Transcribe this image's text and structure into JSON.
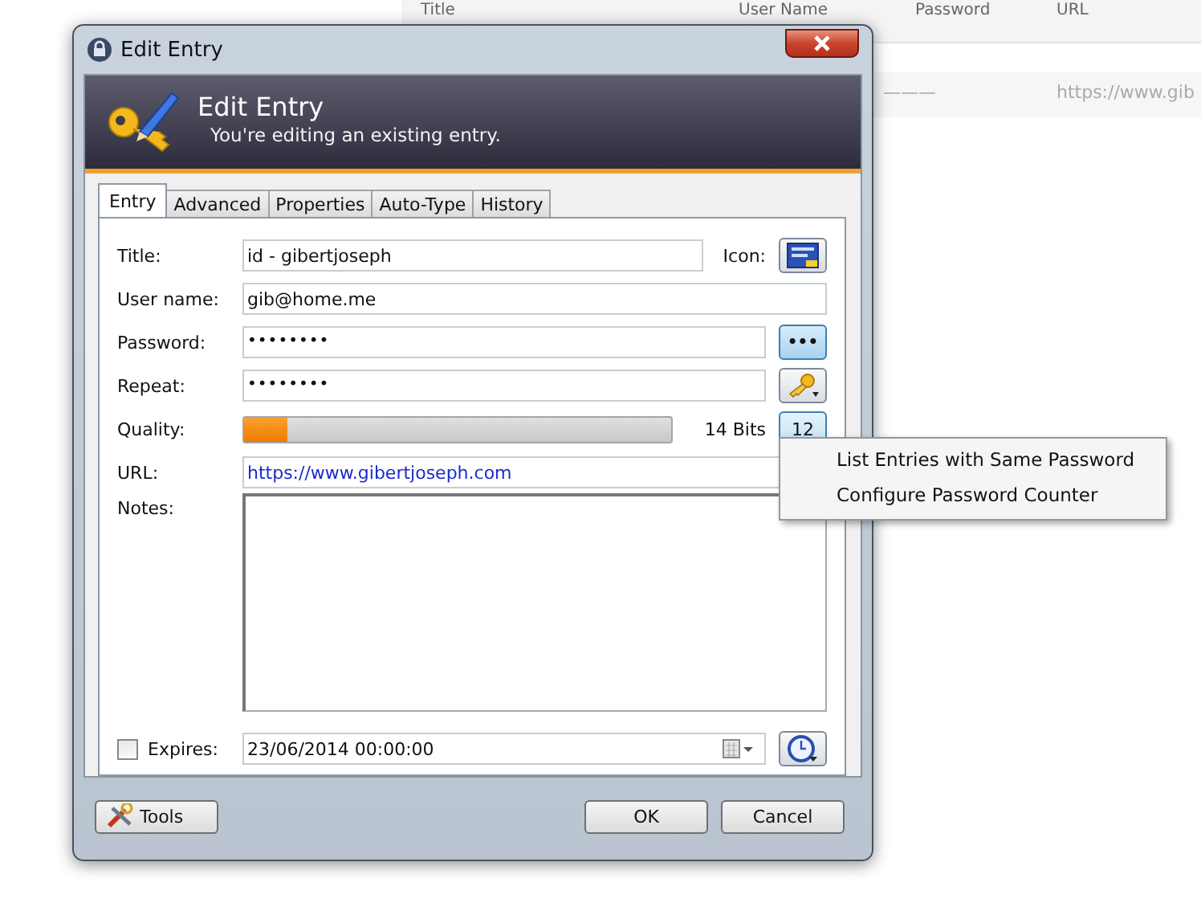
{
  "background_list": {
    "columns": [
      "Title",
      "User Name",
      "Password",
      "URL"
    ],
    "rows": [
      {
        "password": "———",
        "url": "https://www.gib"
      }
    ]
  },
  "window": {
    "title": "Edit Entry"
  },
  "banner": {
    "heading": "Edit Entry",
    "subtitle": "You're editing an existing entry."
  },
  "tabs": [
    {
      "label": "Entry",
      "selected": true
    },
    {
      "label": "Advanced",
      "selected": false
    },
    {
      "label": "Properties",
      "selected": false
    },
    {
      "label": "Auto-Type",
      "selected": false
    },
    {
      "label": "History",
      "selected": false
    }
  ],
  "fields": {
    "title": {
      "label": "Title:",
      "value": "id - gibertjoseph",
      "icon_label": "Icon:"
    },
    "username": {
      "label": "User name:",
      "value": "gib@home.me"
    },
    "password": {
      "label": "Password:",
      "value": "••••••••",
      "toggle": "•••"
    },
    "repeat": {
      "label": "Repeat:",
      "value": "••••••••"
    },
    "quality": {
      "label": "Quality:",
      "level": 0.1,
      "reading": "14 Bits",
      "counter": "12"
    },
    "url": {
      "label": "URL:",
      "value": "https://www.gibertjoseph.com"
    },
    "notes": {
      "label": "Notes:"
    },
    "expires": {
      "label": "Expires:",
      "checked": false,
      "value": "23/06/2014 00:00:00"
    }
  },
  "context_menu": {
    "items": [
      "List Entries with Same Password",
      "Configure Password Counter"
    ]
  },
  "buttons": {
    "tools": "Tools",
    "ok": "OK",
    "cancel": "Cancel"
  }
}
